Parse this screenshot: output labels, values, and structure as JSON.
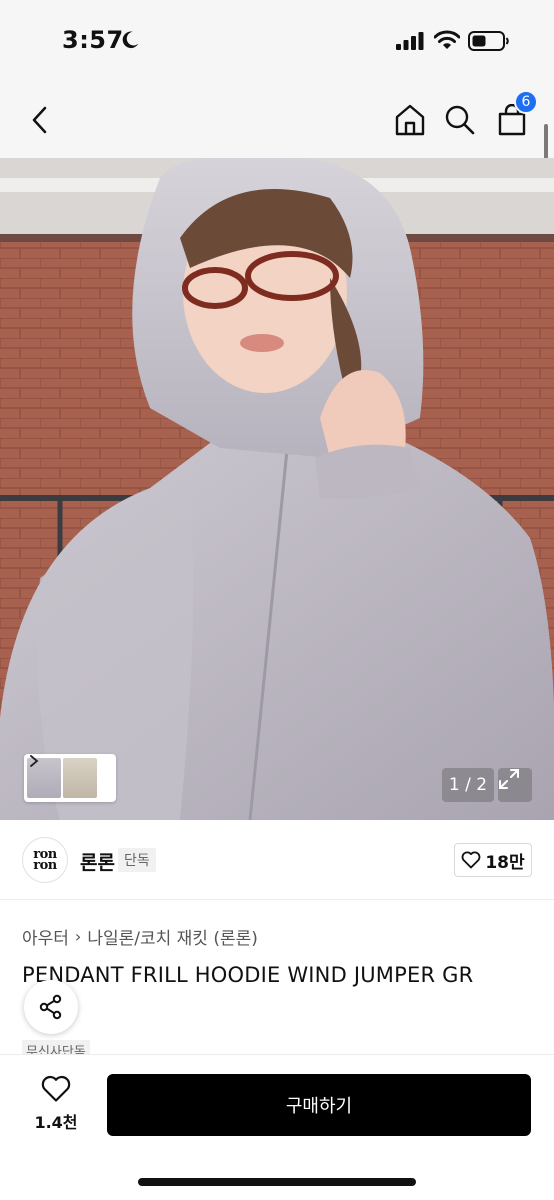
{
  "status_bar": {
    "time": "3:57",
    "icons": [
      "moon-icon",
      "cellular-signal-icon",
      "wifi-icon",
      "battery-icon"
    ]
  },
  "nav": {
    "icons": [
      "chevron-left-icon",
      "home-icon",
      "search-icon",
      "shopping-bag-icon"
    ],
    "cart_badge": "6",
    "accent_color": "#1d6ef2"
  },
  "gallery": {
    "pager": "1 / 2",
    "current_page": 1,
    "total_pages": 2
  },
  "brand": {
    "logo_text": "ron ron",
    "name": "론론",
    "tag": "단독",
    "like_count": "18만"
  },
  "product": {
    "breadcrumb": [
      "아우터",
      "나일론/코치 재킷 (론론)"
    ],
    "title": "PENDANT FRILL HOODIE WIND JUMPER GR",
    "badge": "무신사단독"
  },
  "bottom_bar": {
    "wish_count": "1.4천",
    "buy_label": "구매하기"
  }
}
